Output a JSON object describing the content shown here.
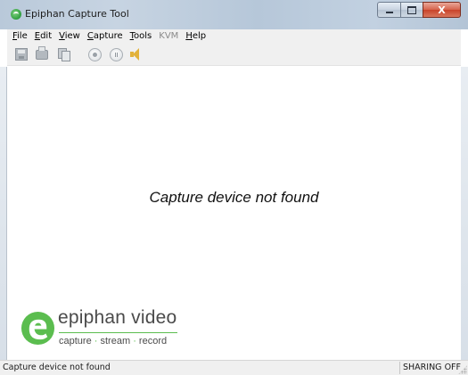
{
  "window": {
    "title": "Epiphan Capture Tool",
    "app_icon": "epiphan-app-icon",
    "controls": {
      "minimize_icon": "minimize-icon",
      "maximize_icon": "maximize-icon",
      "close_label": "X"
    }
  },
  "menu": {
    "items": [
      {
        "accel": "F",
        "rest": "ile"
      },
      {
        "accel": "E",
        "rest": "dit"
      },
      {
        "accel": "V",
        "rest": "iew"
      },
      {
        "accel": "C",
        "rest": "apture"
      },
      {
        "accel": "T",
        "rest": "ools"
      },
      {
        "label": "KVM",
        "disabled": true
      },
      {
        "accel": "H",
        "rest": "elp"
      }
    ]
  },
  "toolbar": {
    "buttons": [
      {
        "icon": "save-icon",
        "enabled": false
      },
      {
        "icon": "print-icon",
        "enabled": false
      },
      {
        "icon": "copy-icon",
        "enabled": false
      },
      {
        "icon": "record-icon",
        "enabled": false
      },
      {
        "icon": "pause-icon",
        "enabled": false
      },
      {
        "icon": "speaker-icon",
        "enabled": true
      }
    ]
  },
  "main": {
    "message": "Capture device not found"
  },
  "logo": {
    "name": "epiphan video",
    "tagline": [
      "capture",
      "stream",
      "record"
    ],
    "separator": "·",
    "brand_color": "#5bbd4f"
  },
  "statusbar": {
    "left_text": "Capture device not found",
    "right_text": "SHARING OFF"
  }
}
